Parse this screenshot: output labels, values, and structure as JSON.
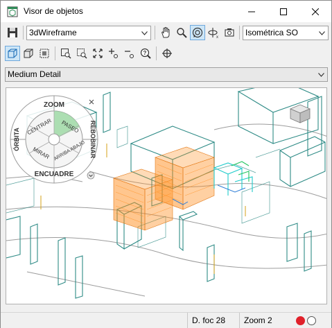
{
  "window": {
    "title": "Visor de objetos"
  },
  "toolbar": {
    "visual_style": "3dWireframe",
    "view_preset": "Isométrica SO"
  },
  "detail": {
    "level": "Medium Detail"
  },
  "steering_wheel": {
    "zoom": "ZOOM",
    "rewind": "REBOBINAR",
    "orbit": "ÓRBITA",
    "center": "CENTRAR",
    "walk": "PASEO",
    "look": "MIRAR",
    "up_down": "ARRIBA ABAJO",
    "pan": "ENCUADRE"
  },
  "status": {
    "focal": "D. foc 28",
    "zoom": "Zoom 2"
  },
  "colors": {
    "accent": "#6fa8dc",
    "wire_teal": "#2e8b86",
    "wire_orange": "#ff8c1a",
    "record_red": "#e0202a"
  },
  "icons": [
    "app-icon",
    "minimize-icon",
    "maximize-icon",
    "close-icon",
    "save-icon",
    "pan-hand-icon",
    "zoom-icon",
    "orbit-icon",
    "constrained-orbit-icon",
    "camera-icon",
    "view-cube-icon",
    "view-solid-icon",
    "view-select-icon",
    "zoom-window-icon",
    "zoom-selected-icon",
    "zoom-extents-icon",
    "zoom-in-icon",
    "zoom-out-icon",
    "zoom-realtime-icon",
    "ucs-icon",
    "steering-wheel-close-icon",
    "steering-wheel-menu-icon",
    "viewcube-icon"
  ]
}
